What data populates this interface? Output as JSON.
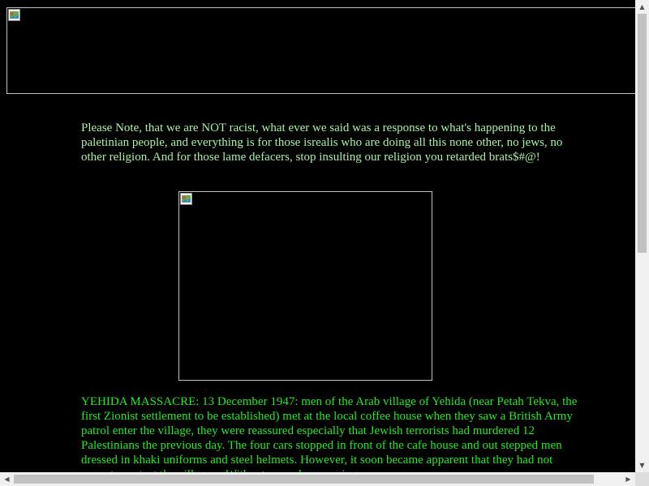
{
  "page": {
    "note_text": "Please Note, that we are NOT racist, what ever we said was a response to what's happening to the paletinian people, and everything is for those isrealis who are doing all this none other, no jews, no other religion. And for those lame defacers, stop insulting our religion you retarded brats$#@!",
    "article_text": "YEHIDA MASSACRE: 13 December 1947: men of the Arab village of Yehida (near Petah Tekva, the first Zionist settlement to be established) met at the local coffee house when they saw a British Army patrol enter the village, they were reassured especially that Jewish terrorists had murdered 12 Palestinians the previous day. The four cars stopped in front of the cafe house and out stepped men dressed in khaki uniforms and steel helmets. However, it soon became apparent that they had not come to protect the villagers. Without a word or warning"
  },
  "images": {
    "banner_icon": "broken-image-icon",
    "figure_icon": "broken-image-icon"
  },
  "scrollbars": {
    "up_arrow": "▲",
    "down_arrow": "▼",
    "left_arrow": "◀",
    "right_arrow": "▶"
  },
  "colors": {
    "background": "#000000",
    "note_text": "#a9f0a9",
    "article_text": "#26e826"
  }
}
